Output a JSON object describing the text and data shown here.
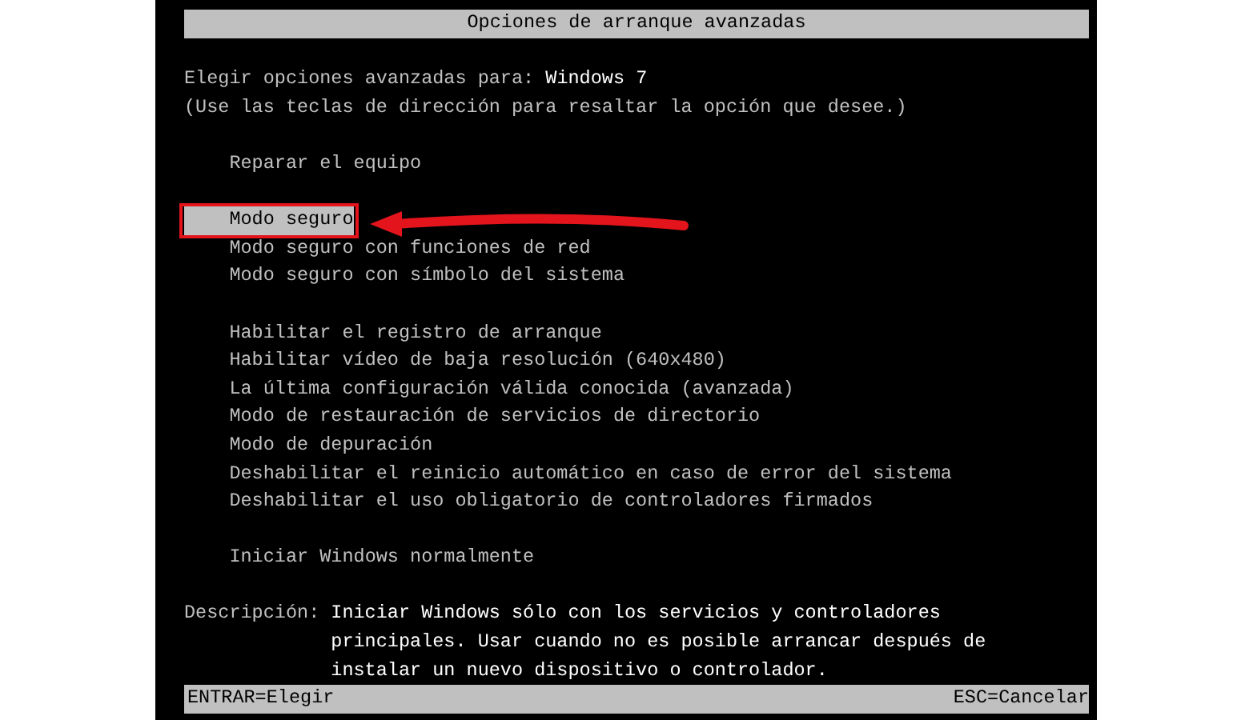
{
  "window": {
    "title": "Opciones de arranque avanzadas"
  },
  "prompt": {
    "label": "Elegir opciones avanzadas para:",
    "os": "Windows 7"
  },
  "hint": "(Use las teclas de dirección para resaltar la opción que desee.)",
  "menu_groups": [
    {
      "items": [
        {
          "label": "Reparar el equipo",
          "selected": false
        }
      ]
    },
    {
      "items": [
        {
          "label": "Modo seguro",
          "selected": true
        },
        {
          "label": "Modo seguro con funciones de red",
          "selected": false
        },
        {
          "label": "Modo seguro con símbolo del sistema",
          "selected": false
        }
      ]
    },
    {
      "items": [
        {
          "label": "Habilitar el registro de arranque",
          "selected": false
        },
        {
          "label": "Habilitar vídeo de baja resolución (640x480)",
          "selected": false
        },
        {
          "label": "La última configuración válida conocida (avanzada)",
          "selected": false
        },
        {
          "label": "Modo de restauración de servicios de directorio",
          "selected": false
        },
        {
          "label": "Modo de depuración",
          "selected": false
        },
        {
          "label": "Deshabilitar el reinicio automático en caso de error del sistema",
          "selected": false
        },
        {
          "label": "Deshabilitar el uso obligatorio de controladores firmados",
          "selected": false
        }
      ]
    },
    {
      "items": [
        {
          "label": "Iniciar Windows normalmente",
          "selected": false
        }
      ]
    }
  ],
  "description": {
    "label": "Descripción:",
    "lines": [
      "Iniciar Windows sólo con los servicios y controladores",
      "principales. Usar cuando no es posible arrancar después de",
      "instalar un nuevo dispositivo o controlador."
    ]
  },
  "status_bar": {
    "left": "ENTRAR=Elegir",
    "right": "ESC=Cancelar"
  }
}
